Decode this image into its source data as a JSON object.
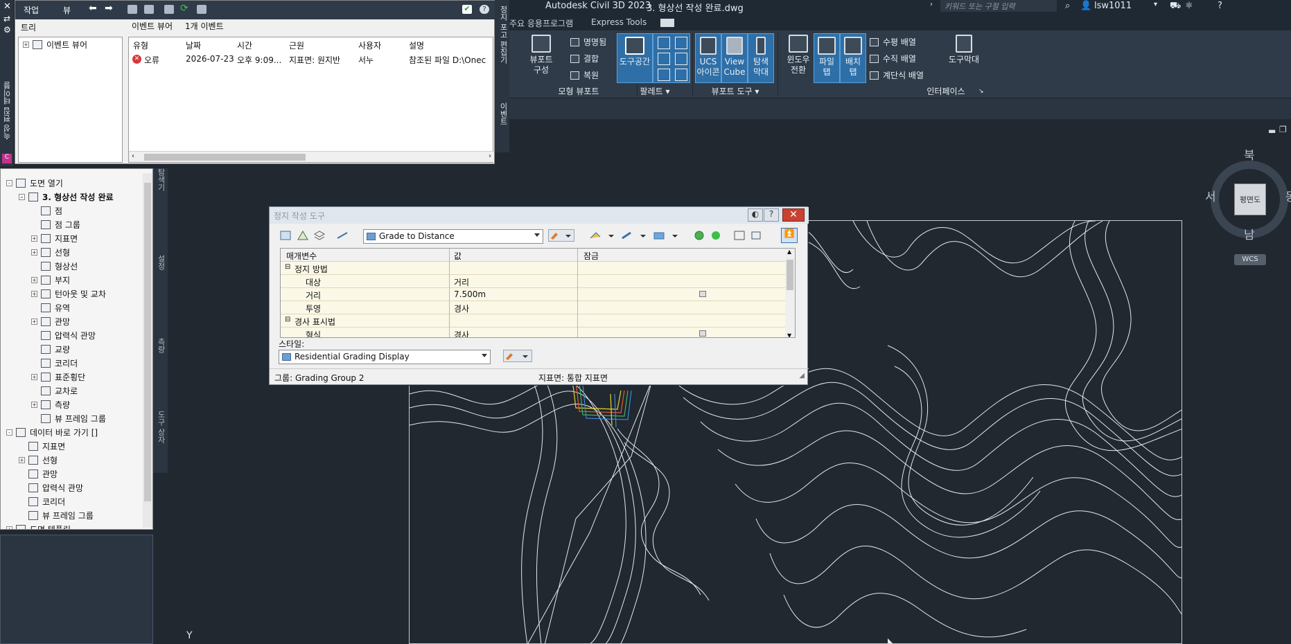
{
  "titlebar": {
    "app": "Autodesk Civil 3D 2023",
    "file": "3. 형상선 작성 완료.dwg",
    "search_placeholder": "키워드 또는 구절 입력",
    "user": "lsw1011"
  },
  "ribbon_tabs": [
    "주요 응용프로그램",
    "Express Tools"
  ],
  "ribbon": {
    "groups": [
      {
        "title": "모형 뷰포트"
      },
      {
        "title": "팔레트 ▾"
      },
      {
        "title": "뷰포트 도구 ▾"
      },
      {
        "title": "인터페이스"
      }
    ],
    "buttons": {
      "viewport_config": "뷰포트 구성",
      "named": "명명됨",
      "join": "결합",
      "restore": "복원",
      "tool_space": "도구공간",
      "ucs_icon": "UCS 아이콘",
      "view_cube": "View Cube",
      "nav_bar": "탐색 막대",
      "switch_window": "윈도우 전환",
      "file_tab": "파일 탭",
      "layout_tab": "배치 탭",
      "tile_horizontal": "수평 배열",
      "tile_vertical": "수직 배열",
      "cascade": "계단식 배열",
      "toolbars": "도구막대"
    }
  },
  "left_strip": {
    "label": "속성 편집 테이블"
  },
  "event_panel": {
    "toolbar": {
      "task": "작업",
      "scale": "뷰"
    },
    "tab_tree": "트리",
    "tab_event_viewer": "이벤트 뷰어",
    "event_count": "1개 이벤트",
    "tree_item": "이벤트 뷰어",
    "columns": [
      "유형",
      "날짜",
      "시간",
      "근원",
      "사용자",
      "설명"
    ],
    "row": {
      "type": "오류",
      "date": "2026-07-23",
      "time": "오후 9:09...",
      "source": "지표면: 원지반",
      "user": "서누",
      "desc": "참조된 파일 D:\\Onec"
    }
  },
  "vstrip2": {
    "labels": [
      "정지 포고 편집기",
      "이벤트"
    ]
  },
  "prospector": {
    "items": [
      {
        "label": "도면 열기",
        "depth": 0,
        "exp": "-"
      },
      {
        "label": "3. 형상선 작성 완료",
        "depth": 1,
        "exp": "-",
        "bold": true
      },
      {
        "label": "점",
        "depth": 2,
        "exp": ""
      },
      {
        "label": "점 그룹",
        "depth": 2,
        "exp": ""
      },
      {
        "label": "지표면",
        "depth": 2,
        "exp": "+"
      },
      {
        "label": "선형",
        "depth": 2,
        "exp": "+"
      },
      {
        "label": "형상선",
        "depth": 2,
        "exp": ""
      },
      {
        "label": "부지",
        "depth": 2,
        "exp": "+"
      },
      {
        "label": "턴아웃 및 교차",
        "depth": 2,
        "exp": "+"
      },
      {
        "label": "유역",
        "depth": 2,
        "exp": ""
      },
      {
        "label": "관망",
        "depth": 2,
        "exp": "+"
      },
      {
        "label": "압력식 관망",
        "depth": 2,
        "exp": ""
      },
      {
        "label": "교량",
        "depth": 2,
        "exp": ""
      },
      {
        "label": "코리더",
        "depth": 2,
        "exp": ""
      },
      {
        "label": "표준횡단",
        "depth": 2,
        "exp": "+"
      },
      {
        "label": "교차로",
        "depth": 2,
        "exp": ""
      },
      {
        "label": "측량",
        "depth": 2,
        "exp": "+"
      },
      {
        "label": "뷰 프레임 그룹",
        "depth": 2,
        "exp": ""
      },
      {
        "label": "데이터 바로 가기 []",
        "depth": 0,
        "exp": "-"
      },
      {
        "label": "지표면",
        "depth": 1,
        "exp": ""
      },
      {
        "label": "선형",
        "depth": 1,
        "exp": "+"
      },
      {
        "label": "관망",
        "depth": 1,
        "exp": ""
      },
      {
        "label": "압력식 관망",
        "depth": 1,
        "exp": ""
      },
      {
        "label": "코리더",
        "depth": 1,
        "exp": ""
      },
      {
        "label": "뷰 프레임 그룹",
        "depth": 1,
        "exp": ""
      },
      {
        "label": "도면 템플릿",
        "depth": 0,
        "exp": "+"
      }
    ]
  },
  "side_tabs": [
    "탐색기",
    "설정",
    "측량",
    "도구 상자"
  ],
  "viewcube": {
    "n": "북",
    "s": "남",
    "w": "서",
    "e": "동",
    "face": "평면도",
    "wcs": "WCS"
  },
  "grading": {
    "title": "정지 작성 도구",
    "criteria": "Grade to Distance",
    "columns": [
      "매개변수",
      "값",
      "잠금"
    ],
    "rows": [
      {
        "param": "정지 방법",
        "value": "",
        "group": true
      },
      {
        "param": "대상",
        "value": "거리",
        "group": false
      },
      {
        "param": "거리",
        "value": "7.500m",
        "group": false,
        "lock": true
      },
      {
        "param": "투영",
        "value": "경사",
        "group": false
      },
      {
        "param": "경사 표시법",
        "value": "",
        "group": true
      },
      {
        "param": "형식",
        "value": "경사",
        "group": false,
        "lock": true
      }
    ],
    "style_label": "스타일:",
    "style": "Residential Grading Display",
    "status_group": "그룹: Grading Group 2",
    "status_surface": "지표면: 통합 지표면"
  },
  "y_axis_label": "Y"
}
